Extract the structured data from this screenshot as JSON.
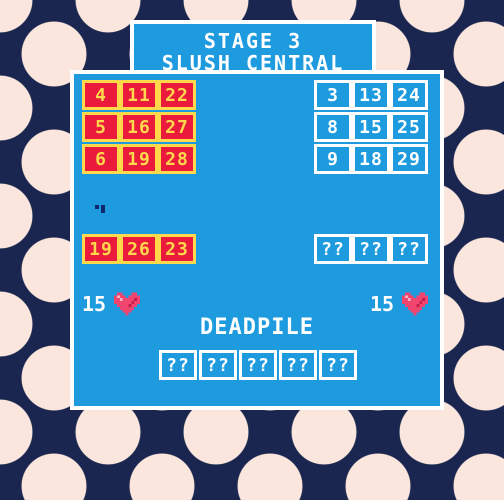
{
  "stage": {
    "line1": "STAGE 3",
    "line2": "SLUSH CENTRAL"
  },
  "player": {
    "board": [
      [
        "4",
        "11",
        "22"
      ],
      [
        "5",
        "16",
        "27"
      ],
      [
        "6",
        "19",
        "28"
      ]
    ],
    "hand": [
      "19",
      "26",
      "23"
    ],
    "lives": "15"
  },
  "opponent": {
    "board": [
      [
        "3",
        "13",
        "24"
      ],
      [
        "8",
        "15",
        "25"
      ],
      [
        "9",
        "18",
        "29"
      ]
    ],
    "hand": [
      "??",
      "??",
      "??"
    ],
    "lives": "15"
  },
  "deadpile": {
    "label": "DEADPILE",
    "cards": [
      "??",
      "??",
      "??",
      "??",
      "??"
    ]
  },
  "colors": {
    "background_dark": "#1b2650",
    "background_dots": "#fbe6dd",
    "panel_blue": "#1e9bdf",
    "player_card_fill": "#e91a3b",
    "player_card_text": "#ffd84b",
    "heart_red": "#f0456f"
  },
  "icons": {
    "lives": "heart-icon",
    "cursor": "cursor-icon"
  }
}
